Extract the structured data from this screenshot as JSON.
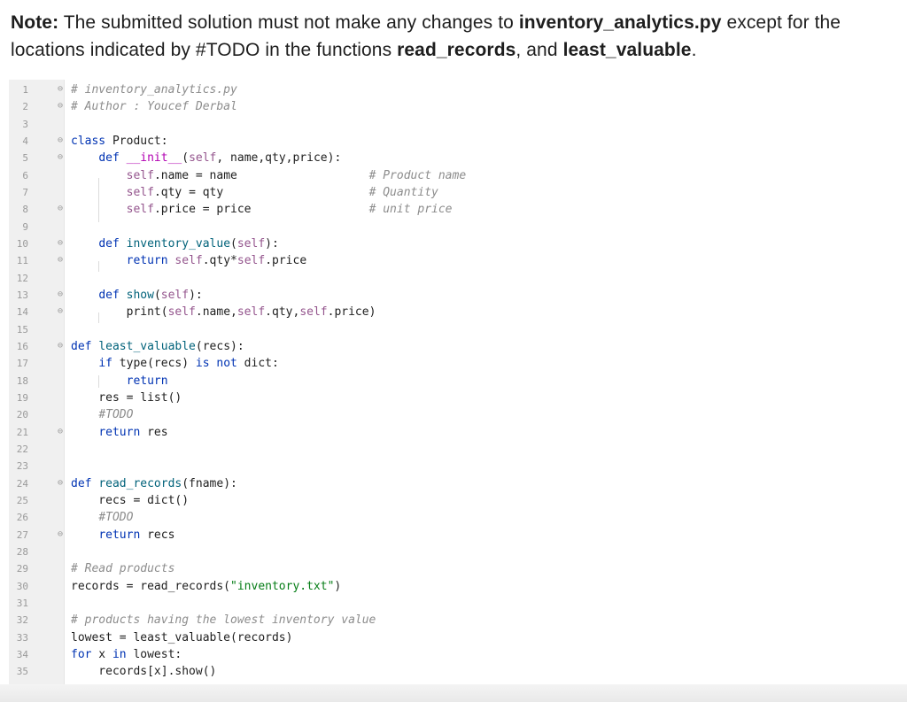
{
  "note": {
    "prefix": "Note:",
    "text1": " The submitted solution must not make any changes to ",
    "file": "inventory_analytics.py",
    "text2": " except for the locations indicated by #TODO in the functions ",
    "fn1": "read_records",
    "text3": ", and ",
    "fn2": "least_valuable",
    "text4": "."
  },
  "code": {
    "lines": [
      {
        "n": "1",
        "fold": "⊖",
        "html": "<span class='cm'># inventory_analytics.py</span>"
      },
      {
        "n": "2",
        "fold": "⊖",
        "html": "<span class='cm'># Author : Youcef Derbal</span>"
      },
      {
        "n": "3",
        "fold": "",
        "html": ""
      },
      {
        "n": "4",
        "fold": "⊖",
        "html": "<span class='kw'>class</span> Product:"
      },
      {
        "n": "5",
        "fold": "⊖",
        "html": "    <span class='kw'>def</span> <span class='mg'>__init__</span>(<span class='self'>self</span>, name,qty,price):"
      },
      {
        "n": "6",
        "fold": "",
        "html": "        <span class='self'>self</span>.name = name                   <span class='cm'># Product name</span>"
      },
      {
        "n": "7",
        "fold": "",
        "html": "        <span class='self'>self</span>.qty = qty                     <span class='cm'># Quantity</span>"
      },
      {
        "n": "8",
        "fold": "⊖",
        "html": "        <span class='self'>self</span>.price = price                 <span class='cm'># unit price</span>"
      },
      {
        "n": "9",
        "fold": "",
        "html": ""
      },
      {
        "n": "10",
        "fold": "⊖",
        "html": "    <span class='kw'>def</span> <span class='fn'>inventory_value</span>(<span class='self'>self</span>):"
      },
      {
        "n": "11",
        "fold": "⊖",
        "html": "        <span class='kw'>return</span> <span class='self'>self</span>.qty*<span class='self'>self</span>.price"
      },
      {
        "n": "12",
        "fold": "",
        "html": ""
      },
      {
        "n": "13",
        "fold": "⊖",
        "html": "    <span class='kw'>def</span> <span class='fn'>show</span>(<span class='self'>self</span>):"
      },
      {
        "n": "14",
        "fold": "⊖",
        "html": "        print(<span class='self'>self</span>.name,<span class='self'>self</span>.qty,<span class='self'>self</span>.price)"
      },
      {
        "n": "15",
        "fold": "",
        "html": ""
      },
      {
        "n": "16",
        "fold": "⊖",
        "html": "<span class='kw'>def</span> <span class='fn'>least_valuable</span>(recs):"
      },
      {
        "n": "17",
        "fold": "",
        "html": "    <span class='kw'>if</span> type(recs) <span class='kw'>is not</span> dict:"
      },
      {
        "n": "18",
        "fold": "",
        "html": "        <span class='kw'>return</span>"
      },
      {
        "n": "19",
        "fold": "",
        "html": "    res = list()"
      },
      {
        "n": "20",
        "fold": "",
        "html": "    <span class='cm'>#TODO</span>"
      },
      {
        "n": "21",
        "fold": "⊖",
        "html": "    <span class='kw'>return</span> res"
      },
      {
        "n": "22",
        "fold": "",
        "html": ""
      },
      {
        "n": "23",
        "fold": "",
        "html": ""
      },
      {
        "n": "24",
        "fold": "⊖",
        "html": "<span class='kw'>def</span> <span class='fn'>read_records</span>(fname):"
      },
      {
        "n": "25",
        "fold": "",
        "html": "    recs = dict()"
      },
      {
        "n": "26",
        "fold": "",
        "html": "    <span class='cm'>#TODO</span>"
      },
      {
        "n": "27",
        "fold": "⊖",
        "html": "    <span class='kw'>return</span> recs"
      },
      {
        "n": "28",
        "fold": "",
        "html": ""
      },
      {
        "n": "29",
        "fold": "",
        "html": "<span class='cm'># Read products</span>"
      },
      {
        "n": "30",
        "fold": "",
        "html": "records = read_records(<span class='str'>\"inventory.txt\"</span>)"
      },
      {
        "n": "31",
        "fold": "",
        "html": ""
      },
      {
        "n": "32",
        "fold": "",
        "html": "<span class='cm'># products having the lowest inventory value</span>"
      },
      {
        "n": "33",
        "fold": "",
        "html": "lowest = least_valuable(records)"
      },
      {
        "n": "34",
        "fold": "",
        "html": "<span class='kw'>for</span> x <span class='kw'>in</span> lowest:"
      },
      {
        "n": "35",
        "fold": "",
        "html": "    records[x].show()"
      }
    ]
  }
}
